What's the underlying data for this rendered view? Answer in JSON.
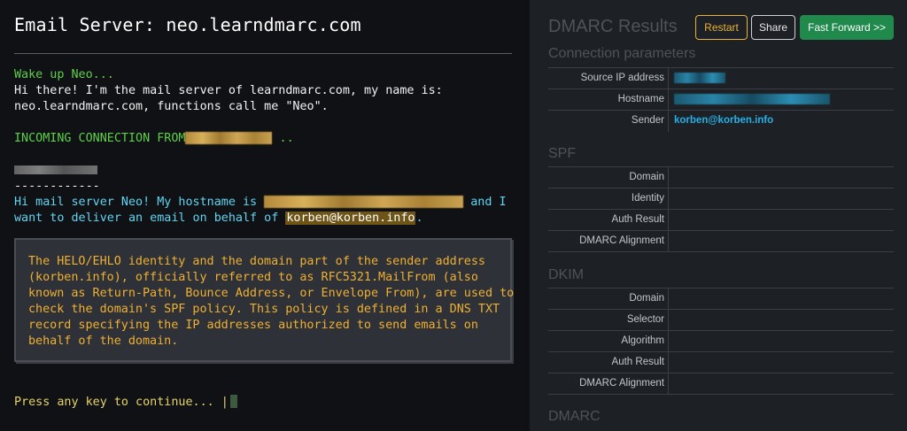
{
  "terminal": {
    "title": "Email Server: neo.learndmarc.com",
    "wake": "Wake up Neo...",
    "intro1": "Hi there! I'm the mail server of learndmarc.com, my name is:",
    "intro2": "neo.learndmarc.com, functions call me \"Neo\".",
    "incoming": "INCOMING CONNECTION FROM",
    "incoming_tail": " ..",
    "dashes": "------------",
    "client1_a": "Hi mail server Neo! My hostname is ",
    "client1_b": " and I",
    "client2_a": "want to deliver an email on behalf of ",
    "client2_sender": "korben@korben.info",
    "client2_b": ".",
    "info": "The HELO/EHLO identity and the domain part of the sender address\n(korben.info), officially referred to as RFC5321.MailFrom (also\nknown as Return-Path, Bounce Address, or Envelope From), are used to\ncheck the domain's SPF policy. This policy is defined in a DNS TXT\nrecord specifying the IP addresses authorized to send emails on\nbehalf of the domain.",
    "prompt": "Press any key to continue... |"
  },
  "results": {
    "title": "DMARC Results",
    "buttons": {
      "restart": "Restart",
      "share": "Share",
      "fast_forward": "Fast Forward >>"
    },
    "connection": {
      "heading": "Connection parameters",
      "source_ip_label": "Source IP address",
      "hostname_label": "Hostname",
      "sender_label": "Sender",
      "sender_value": "korben@korben.info"
    },
    "spf": {
      "heading": "SPF",
      "rows": [
        "Domain",
        "Identity",
        "Auth Result",
        "DMARC Alignment"
      ]
    },
    "dkim": {
      "heading": "DKIM",
      "rows": [
        "Domain",
        "Selector",
        "Algorithm",
        "Auth Result",
        "DMARC Alignment"
      ]
    },
    "dmarc": {
      "heading": "DMARC"
    }
  },
  "colors": {
    "terminal_bg": "#0f1115",
    "green": "#5ed04a",
    "cyan": "#62d4f0",
    "info_text": "#f0b030",
    "link_blue": "#26b0e6",
    "restart_border": "#e8b33a",
    "fast_forward_bg": "#1f8a4c"
  }
}
